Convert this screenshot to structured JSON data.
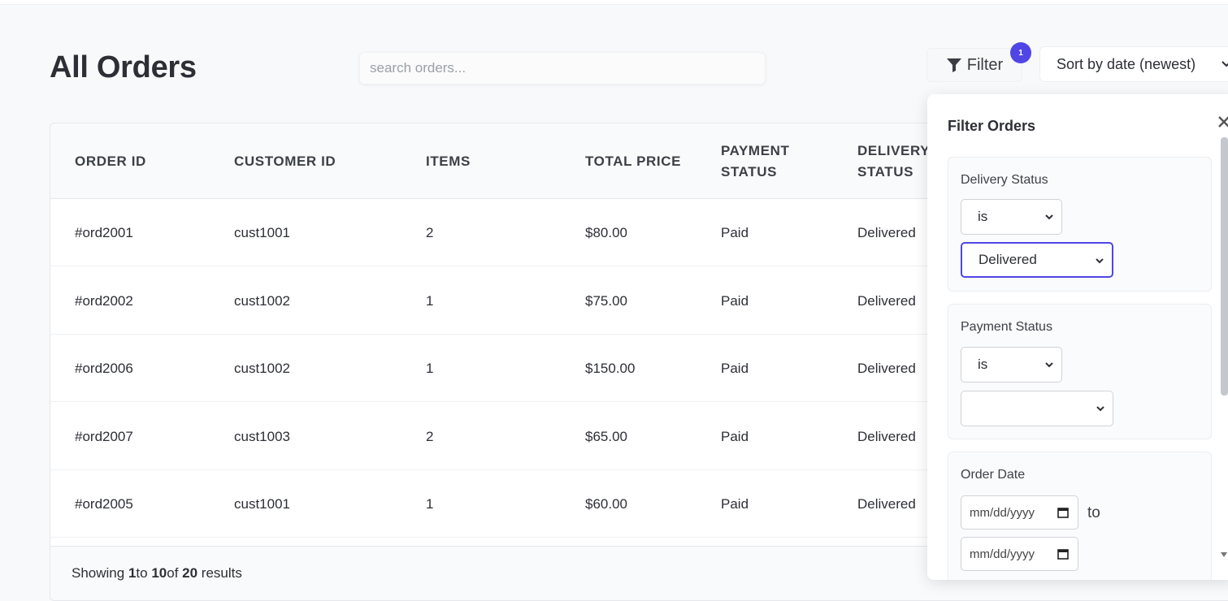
{
  "page": {
    "title": "All Orders"
  },
  "search": {
    "placeholder": "search orders..."
  },
  "filter": {
    "label": "Filter",
    "badge": "1"
  },
  "sort": {
    "label": "Sort by date (newest)"
  },
  "table": {
    "headers": {
      "order_id": "ORDER ID",
      "customer_id": "CUSTOMER ID",
      "items": "ITEMS",
      "total_price": "TOTAL PRICE",
      "payment_status": "PAYMENT STATUS",
      "delivery_status": "DELIVERY STATUS"
    },
    "rows": [
      {
        "order_id": "#ord2001",
        "customer_id": "cust1001",
        "items": "2",
        "total_price": "$80.00",
        "payment_status": "Paid",
        "delivery_status": "Delivered"
      },
      {
        "order_id": "#ord2002",
        "customer_id": "cust1002",
        "items": "1",
        "total_price": "$75.00",
        "payment_status": "Paid",
        "delivery_status": "Delivered"
      },
      {
        "order_id": "#ord2006",
        "customer_id": "cust1002",
        "items": "1",
        "total_price": "$150.00",
        "payment_status": "Paid",
        "delivery_status": "Delivered"
      },
      {
        "order_id": "#ord2007",
        "customer_id": "cust1003",
        "items": "2",
        "total_price": "$65.00",
        "payment_status": "Paid",
        "delivery_status": "Delivered"
      },
      {
        "order_id": "#ord2005",
        "customer_id": "cust1001",
        "items": "1",
        "total_price": "$60.00",
        "payment_status": "Paid",
        "delivery_status": "Delivered"
      }
    ],
    "footer": {
      "prefix": "Showing ",
      "from": "1",
      "to_word": "to ",
      "to": "10",
      "of_word": "of ",
      "total": "20",
      "suffix": " results"
    }
  },
  "filter_panel": {
    "title": "Filter Orders",
    "delivery": {
      "label": "Delivery Status",
      "operator": "is",
      "value": "Delivered"
    },
    "payment": {
      "label": "Payment Status",
      "operator": "is",
      "value": ""
    },
    "order_date": {
      "label": "Order Date",
      "from_placeholder": "mm/dd/yyyy",
      "to_word": "to",
      "to_placeholder": "mm/dd/yyyy"
    }
  },
  "colors": {
    "accent": "#4f46e5"
  }
}
